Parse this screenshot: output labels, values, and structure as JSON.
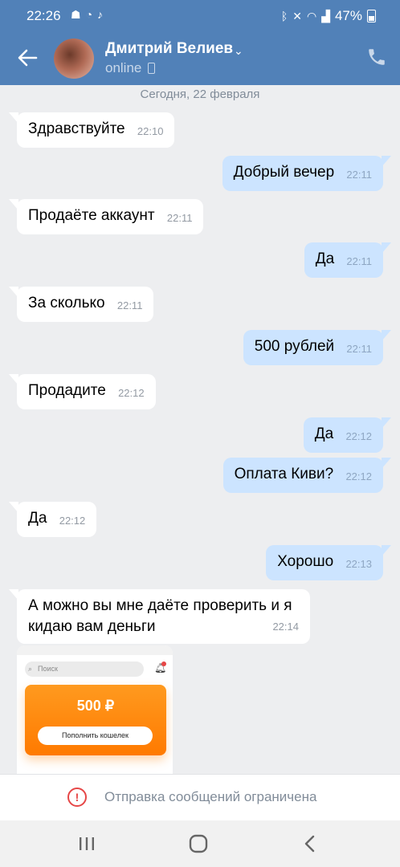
{
  "status_bar": {
    "time": "22:26",
    "left_icons": [
      "notification-icon",
      "incognito-icon",
      "tiktok-icon"
    ],
    "right_icons": [
      "bluetooth-icon",
      "mute-icon",
      "wifi-icon",
      "signal-icon"
    ],
    "battery": "47%"
  },
  "header": {
    "contact_name": "Дмитрий Велиев",
    "status": "online"
  },
  "chat": {
    "date_separator": "Сегодня, 22 февраля",
    "messages": [
      {
        "dir": "in",
        "text": "Здравствуйте",
        "time": "22:10"
      },
      {
        "dir": "out",
        "text": "Добрый вечер",
        "time": "22:11"
      },
      {
        "dir": "in",
        "text": "Продаёте аккаунт",
        "time": "22:11"
      },
      {
        "dir": "out",
        "text": "Да",
        "time": "22:11"
      },
      {
        "dir": "in",
        "text": "За сколько",
        "time": "22:11"
      },
      {
        "dir": "out",
        "text": "500 рублей",
        "time": "22:11"
      },
      {
        "dir": "in",
        "text": "Продадите",
        "time": "22:12"
      },
      {
        "dir": "out",
        "text": "Да",
        "time": "22:12"
      },
      {
        "dir": "out",
        "text": "Оплата Киви?",
        "time": "22:12"
      },
      {
        "dir": "in",
        "text": "Да",
        "time": "22:12"
      },
      {
        "dir": "out",
        "text": "Хорошо",
        "time": "22:13"
      },
      {
        "dir": "in",
        "text": "А можно вы мне даёте проверить и я кидаю вам деньги",
        "time": "22:14"
      }
    ],
    "image_preview": {
      "search_placeholder": "Поиск",
      "balance": "500 ₽",
      "topup_button": "Пополнить кошелек"
    }
  },
  "restricted_bar": {
    "text": "Отправка сообщений ограничена"
  },
  "colors": {
    "header": "#5181b8",
    "outgoing_bubble": "#cce4ff",
    "incoming_bubble": "#ffffff",
    "chat_background": "#edeef0",
    "warning": "#e64646"
  }
}
